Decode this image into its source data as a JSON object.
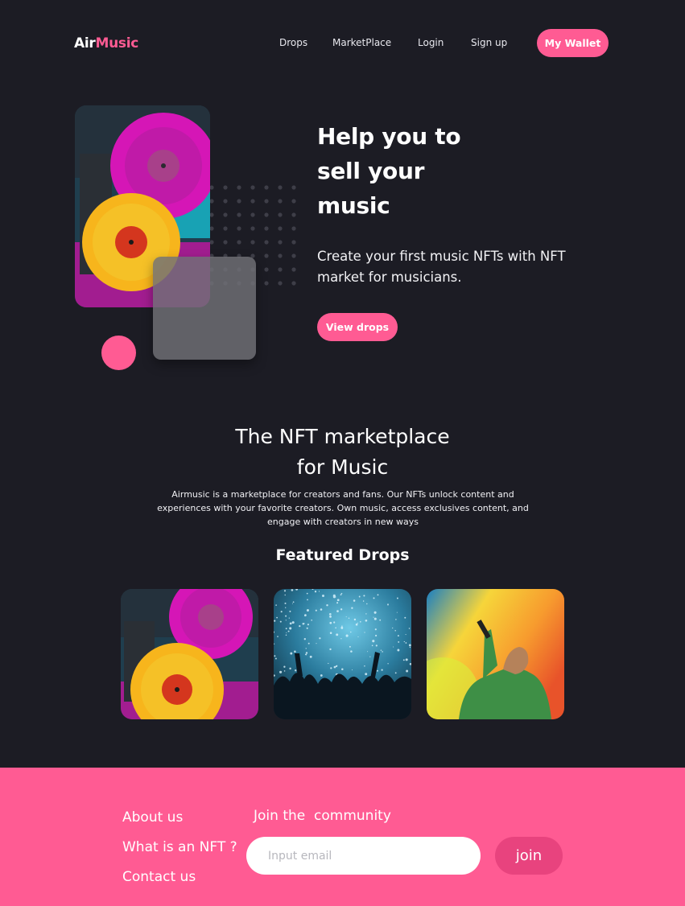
{
  "nav": {
    "logo_part1": "Air",
    "logo_part2": "Music",
    "links": [
      "Drops",
      "MarketPlace",
      "Login",
      "Sign up"
    ],
    "wallet_button": "My Wallet"
  },
  "hero": {
    "title_lines": [
      "Help you to",
      "sell your",
      "music"
    ],
    "subtitle": "Create your first music NFTs with NFT market for musicians.",
    "cta": "View drops"
  },
  "marketplace": {
    "title_lines": [
      "The NFT marketplace",
      "for Music"
    ],
    "description": "Airmusic is a marketplace for creators and fans.  Our  NFTs unlock content and experiences with your favorite creators. Own  music, access exclusives content, and engage with creators in new ways",
    "featured_title": "Featured Drops",
    "drops": [
      {
        "image": "vinyl-records-image"
      },
      {
        "image": "concert-crowd-image"
      },
      {
        "image": "singer-on-stage-image"
      }
    ]
  },
  "footer": {
    "links": [
      "About us",
      "What is an NFT ?",
      "Contact us"
    ],
    "join_title": "Join the  community",
    "email_placeholder": "Input email",
    "join_button": "join"
  },
  "colors": {
    "background": "#1c1c24",
    "accent": "#ff5b93",
    "join_button": "#e8437e"
  }
}
